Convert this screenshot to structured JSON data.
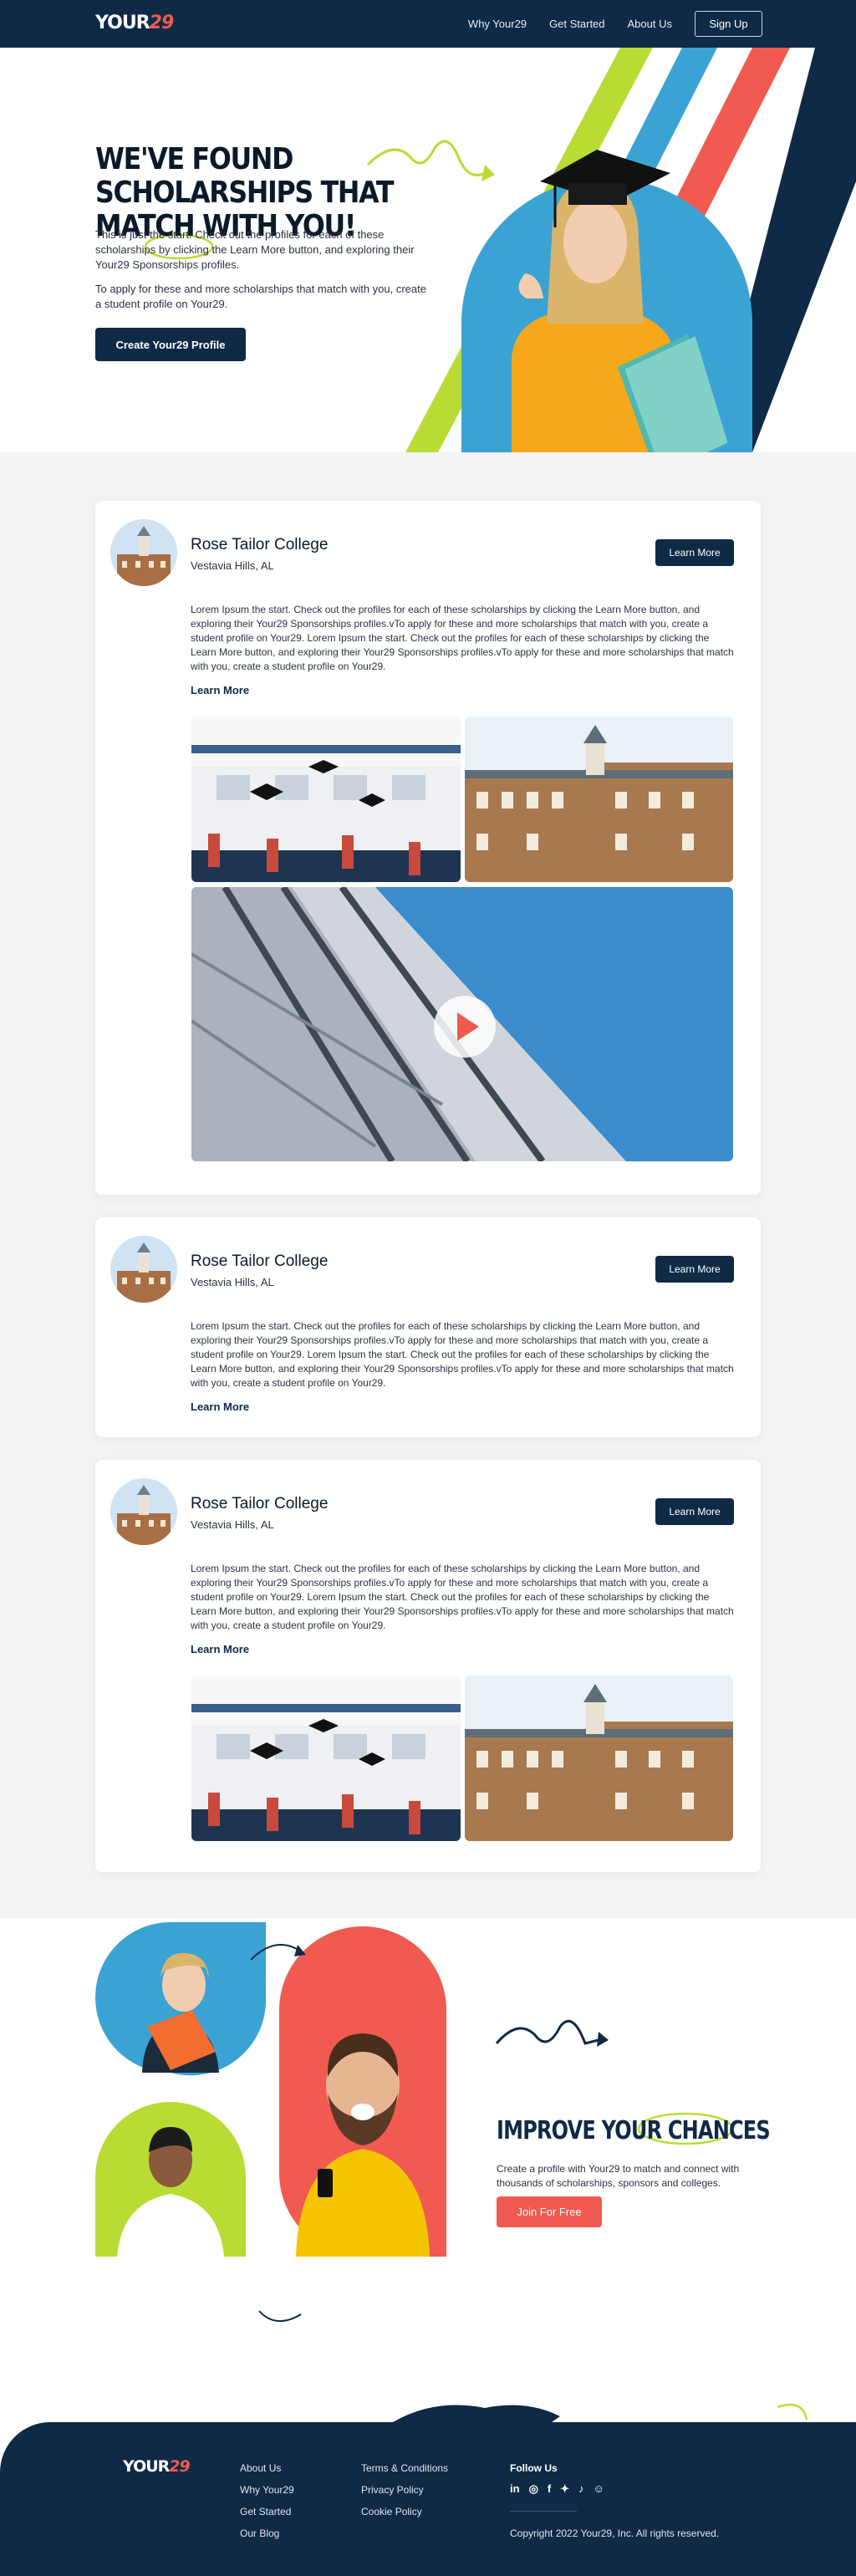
{
  "nav": {
    "logo_text": "YOUR",
    "logo_num": "29",
    "links": [
      "Why Your29",
      "Get Started",
      "About Us"
    ],
    "signup": "Sign Up"
  },
  "hero": {
    "title": "WE'VE FOUND SCHOLARSHIPS THAT MATCH WITH YOU!",
    "p1": "This is just the start. Check out the profiles for each of these scholarships by clicking the Learn More button, and exploring their Your29 Sponsorships profiles.",
    "p2": "To apply for these and more scholarships that match with you, create a student profile on Your29.",
    "button": "Create Your29 Profile"
  },
  "cards": [
    {
      "title": "Rose Tailor College",
      "location": "Vestavia Hills, AL",
      "button": "Learn More",
      "desc": "Lorem Ipsum the start. Check out the profiles for each of these scholarships by clicking the Learn More button, and exploring their Your29 Sponsorships profiles.vTo apply for these and more scholarships that match with you, create a student profile on Your29. Lorem Ipsum the start. Check out the profiles for each of these scholarships by clicking the Learn More button, and exploring their Your29 Sponsorships profiles.vTo apply for these and more scholarships that match with you, create a student profile on Your29.",
      "link": "Learn More"
    },
    {
      "title": "Rose Tailor College",
      "location": "Vestavia Hills, AL",
      "button": "Learn More",
      "desc": "Lorem Ipsum the start. Check out the profiles for each of these scholarships by clicking the Learn More button, and exploring their Your29 Sponsorships profiles.vTo apply for these and more scholarships that match with you, create a student profile on Your29. Lorem Ipsum the start. Check out the profiles for each of these scholarships by clicking the Learn More button, and exploring their Your29 Sponsorships profiles.vTo apply for these and more scholarships that match with you, create a student profile on Your29.",
      "link": "Learn More"
    },
    {
      "title": "Rose Tailor College",
      "location": "Vestavia Hills, AL",
      "button": "Learn More",
      "desc": "Lorem Ipsum the start. Check out the profiles for each of these scholarships by clicking the Learn More button, and exploring their Your29 Sponsorships profiles.vTo apply for these and more scholarships that match with you, create a student profile on Your29. Lorem Ipsum the start. Check out the profiles for each of these scholarships by clicking the Learn More button, and exploring their Your29 Sponsorships profiles.vTo apply for these and more scholarships that match with you, create a student profile on Your29.",
      "link": "Learn More"
    }
  ],
  "improve": {
    "title": "IMPROVE YOUR CHANCES",
    "text": "Create a profile with Your29 to match and connect with thousands of scholarships, sponsors and colleges.",
    "button": "Join For Free"
  },
  "footer": {
    "logo_text": "YOUR",
    "logo_num": "29",
    "col1": [
      "About Us",
      "Why Your29",
      "Get Started",
      "Our Blog"
    ],
    "col2": [
      "Terms & Conditions",
      "Privacy Policy",
      "Cookie Policy"
    ],
    "follow": "Follow Us",
    "socials": [
      "in",
      "◎",
      "f",
      "✦",
      "♪",
      "☺"
    ],
    "copyright": "Copyright 2022 Your29, Inc. All rights reserved."
  },
  "colors": {
    "navy": "#0e2a47",
    "coral": "#f05a50",
    "sky": "#3ba3d4",
    "lime": "#b8dc34",
    "yellow": "#f5b800"
  },
  "icons": {
    "play": "play-icon",
    "socials": [
      "linkedin-icon",
      "instagram-icon",
      "facebook-icon",
      "twitter-icon",
      "tiktok-icon",
      "snapchat-icon"
    ]
  }
}
